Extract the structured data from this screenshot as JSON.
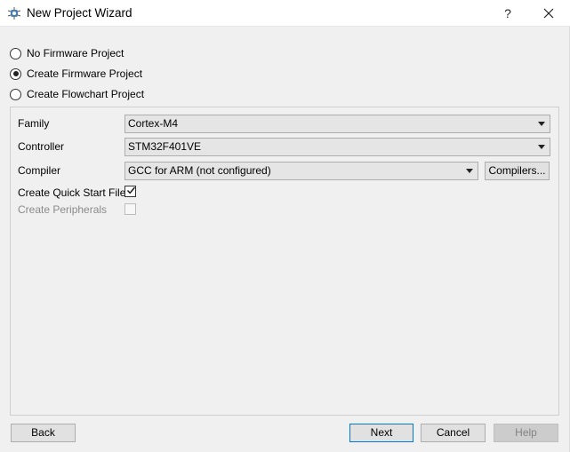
{
  "window": {
    "title": "New Project Wizard",
    "help_glyph": "?"
  },
  "project_type": {
    "options": [
      {
        "label": "No Firmware Project",
        "checked": false
      },
      {
        "label": "Create Firmware Project",
        "checked": true
      },
      {
        "label": "Create Flowchart Project",
        "checked": false
      }
    ]
  },
  "form": {
    "family_label": "Family",
    "family_value": "Cortex-M4",
    "controller_label": "Controller",
    "controller_value": "STM32F401VE",
    "compiler_label": "Compiler",
    "compiler_value": "GCC for ARM (not configured)",
    "compilers_button": "Compilers...",
    "quick_start_label": "Create Quick Start Files",
    "quick_start_checked": true,
    "peripherals_label": "Create Peripherals",
    "peripherals_checked": false
  },
  "footer": {
    "back": "Back",
    "next": "Next",
    "cancel": "Cancel",
    "help": "Help"
  }
}
